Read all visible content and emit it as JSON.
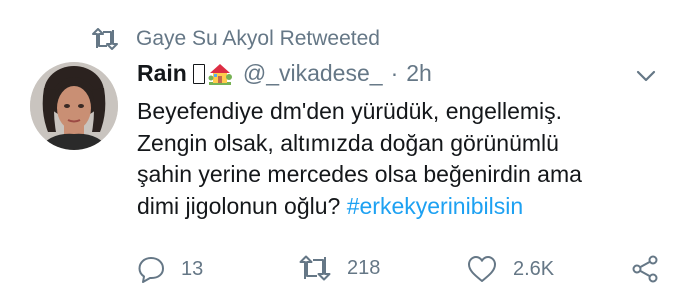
{
  "retweet": {
    "icon": "retweet-icon",
    "label": "Gaye Su Akyol Retweeted"
  },
  "tweet": {
    "author_name": "Rain",
    "name_emojis": [
      "unknown-glyph-box",
      "house-with-garden-emoji"
    ],
    "handle": "@_vikadese_",
    "separator": "·",
    "time": "2h",
    "text_lines": [
      "Beyefendiye dm'den yürüdük, engellemiş.",
      "Zengin olsak, altımızda doğan görünümlü",
      "şahin yerine mercedes olsa beğenirdin ama",
      "dimi jigolonun oğlu?"
    ],
    "hashtag": "#erkekyerinibilsin"
  },
  "actions": {
    "reply_count": "13",
    "retweet_count": "218",
    "like_count": "2.6K"
  },
  "colors": {
    "text": "#14171a",
    "secondary": "#657786",
    "link": "#1da1f2",
    "background": "#ffffff"
  }
}
